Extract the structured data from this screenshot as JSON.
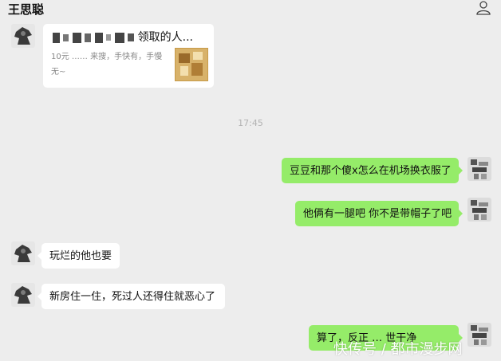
{
  "header": {
    "title": "王思聪"
  },
  "link_card": {
    "title": "领取的人...",
    "description": "10元 …… 来搜，手快有，手慢无~"
  },
  "timestamp": "17:45",
  "messages": [
    {
      "side": "right",
      "text": "豆豆和那个傻x怎么在机场换衣服了"
    },
    {
      "side": "right",
      "text": "他俩有一腿吧 你不是带帽子了吧"
    },
    {
      "side": "left",
      "text": "玩烂的他也要"
    },
    {
      "side": "left",
      "text": "新房住一住，死过人还得住就恶心了"
    },
    {
      "side": "right",
      "text": "算了，反正 … 世干净"
    }
  ],
  "watermark": "快传号 / 都市漫步网",
  "colors": {
    "background": "#ededed",
    "incoming_bubble": "#ffffff",
    "outgoing_bubble": "#95ec69",
    "timestamp": "#b2b2b2"
  },
  "icons": {
    "profile": "person-icon",
    "contact_avatar": "contact-avatar",
    "my_avatar": "user-avatar"
  }
}
